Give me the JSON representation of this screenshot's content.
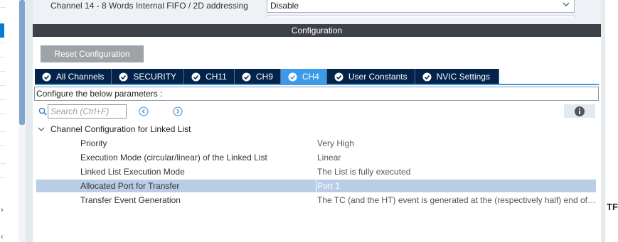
{
  "top_param": {
    "label": "Channel 14 - 8 Words Internal FIFO / 2D addressing",
    "value": "Disable"
  },
  "config_header": "Configuration",
  "reset_button": "Reset Configuration",
  "tabs": [
    {
      "label": "All Channels",
      "active": false
    },
    {
      "label": "SECURITY",
      "active": false
    },
    {
      "label": "CH11",
      "active": false
    },
    {
      "label": "CH9",
      "active": false
    },
    {
      "label": "CH4",
      "active": true
    },
    {
      "label": "User Constants",
      "active": false
    },
    {
      "label": "NVIC Settings",
      "active": false
    }
  ],
  "hint": "Configure the below parameters :",
  "search": {
    "placeholder": "Search (Ctrl+F)"
  },
  "group": {
    "label": "Channel Configuration for Linked List",
    "expanded": true
  },
  "params": [
    {
      "name": "Priority",
      "value": "Very High",
      "selected": false
    },
    {
      "name": "Execution Mode (circular/linear) of the Linked List",
      "value": "Linear",
      "selected": false
    },
    {
      "name": "Linked List Execution Mode",
      "value": "The List is fully executed",
      "selected": false
    },
    {
      "name": "Allocated Port for Transfer",
      "value": "Port 1",
      "selected": true
    },
    {
      "name": "Transfer Event Generation",
      "value": "The TC (and the HT) event is generated at the (respectively half) end of each block",
      "selected": false
    }
  ],
  "right_edge_text": "TF",
  "colors": {
    "tab_bg": "#03234b",
    "tab_active": "#3c9ae8",
    "selected_row": "#b9cde5",
    "header_bar": "#3c4247"
  }
}
